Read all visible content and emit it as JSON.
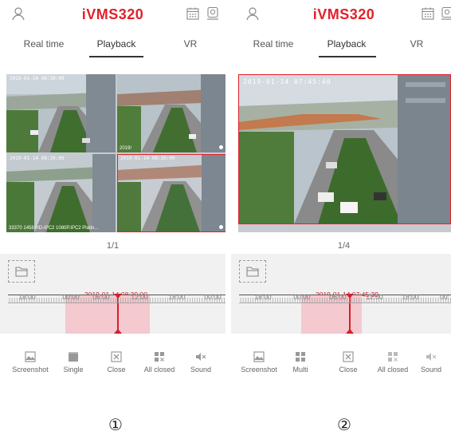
{
  "phones": [
    {
      "brand": "iVMS320",
      "tabs": [
        "Real time",
        "Playback",
        "VR"
      ],
      "page": "1/1",
      "timestamp": "2019-01-14 08:39:00",
      "cell_timestamps": [
        "2019-01-14 08:39:00",
        "",
        "2019-01-14 08:39:00",
        "2019-01-14 08:39:00"
      ],
      "cell_caption": "33370 1458 HD-IPC2 1080P.IPC2 Platin...",
      "cell_caption_2": "2019/",
      "tick_labels": [
        "18:00",
        "00:00",
        "06:00",
        "12:00",
        "18:00",
        "00:00"
      ],
      "toolbar": [
        "Screenshot",
        "Single",
        "Close",
        "All closed",
        "Sound"
      ],
      "circled": "①"
    },
    {
      "brand": "iVMS320",
      "tabs": [
        "Real time",
        "Playback",
        "VR"
      ],
      "page": "1/4",
      "timestamp": "2019-01-14 07:45:39",
      "cell_timestamps": [
        "2019-01-14 07:45:40"
      ],
      "tick_labels": [
        "18:00",
        "00:00",
        "06:00",
        "12:00",
        "18:00",
        "00:"
      ],
      "toolbar": [
        "Screenshot",
        "Multi",
        "Close",
        "All closed",
        "Sound"
      ],
      "circled": "②"
    }
  ],
  "colors": {
    "brand": "#e3202a",
    "accent": "#d4202c",
    "highlight": "#f4c9cf",
    "panel": "#f1f1f1"
  },
  "icons": [
    "user-icon",
    "calendar-icon",
    "location-icon",
    "folder-icon",
    "screenshot-icon",
    "grid-icon",
    "close-icon",
    "all-closed-icon",
    "mute-icon"
  ]
}
